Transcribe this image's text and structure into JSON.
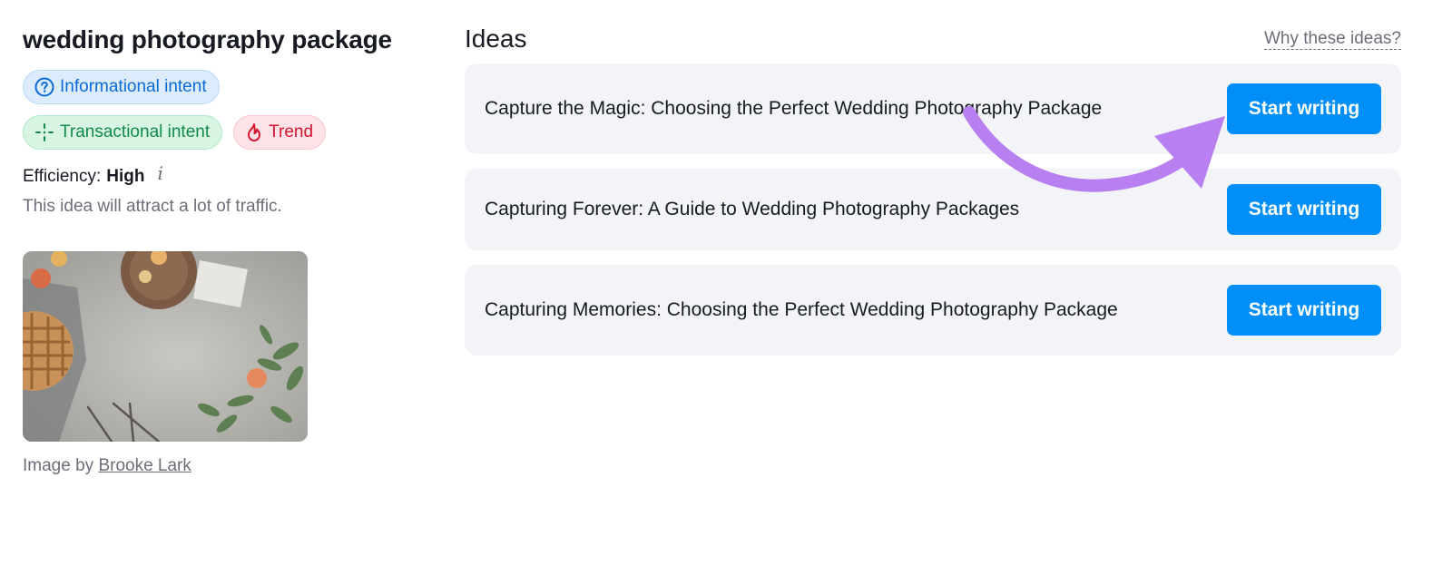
{
  "keyword": {
    "title": "wedding photography package"
  },
  "badges": {
    "informational": "Informational intent",
    "transactional": "Transactional intent",
    "trend": "Trend"
  },
  "efficiency": {
    "label": "Efficiency:",
    "value": "High",
    "info_icon": "info-icon",
    "description": "This idea will attract a lot of traffic."
  },
  "image": {
    "credit_prefix": "Image by",
    "credit_author": "Brooke Lark"
  },
  "ideas": {
    "title": "Ideas",
    "why_link": "Why these ideas?",
    "items": [
      {
        "text": "Capture the Magic: Choosing the Perfect Wedding Photography Package",
        "button": "Start writing"
      },
      {
        "text": "Capturing Forever: A Guide to Wedding Photography Packages",
        "button": "Start writing"
      },
      {
        "text": "Capturing Memories: Choosing the Perfect Wedding Photography Package",
        "button": "Start writing"
      }
    ]
  },
  "colors": {
    "accent": "#008ff8",
    "annotation_arrow": "#b77ff0"
  }
}
